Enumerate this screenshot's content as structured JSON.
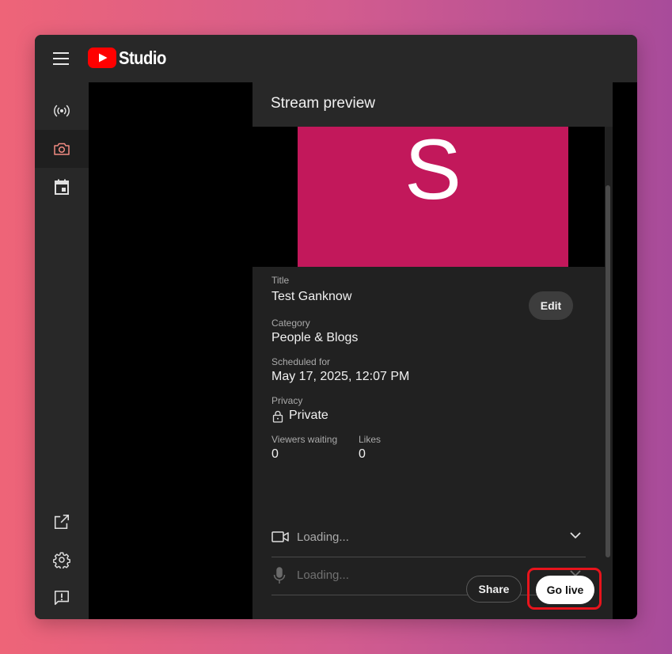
{
  "app": {
    "name": "Studio"
  },
  "sidebar": {
    "items": [
      {
        "icon": "live-broadcast-icon",
        "active": false
      },
      {
        "icon": "camera-icon",
        "active": true
      },
      {
        "icon": "calendar-icon",
        "active": false
      }
    ],
    "bottom_items": [
      {
        "icon": "external-link-icon"
      },
      {
        "icon": "gear-icon"
      },
      {
        "icon": "feedback-icon"
      }
    ]
  },
  "panel": {
    "title": "Stream preview",
    "thumbnail_letter": "S",
    "thumbnail_color": "#c2185b",
    "fields": {
      "title_label": "Title",
      "title_value": "Test Ganknow",
      "category_label": "Category",
      "category_value": "People & Blogs",
      "scheduled_label": "Scheduled for",
      "scheduled_value": "May 17, 2025, 12:07 PM",
      "privacy_label": "Privacy",
      "privacy_value": "Private",
      "viewers_label": "Viewers waiting",
      "viewers_value": "0",
      "likes_label": "Likes",
      "likes_value": "0"
    },
    "edit_label": "Edit",
    "camera_status": "Loading...",
    "mic_status": "Loading...",
    "share_label": "Share",
    "golive_label": "Go live"
  },
  "colors": {
    "accent": "#ff0000",
    "highlight": "#e8141c",
    "active_icon": "#f28b82"
  }
}
